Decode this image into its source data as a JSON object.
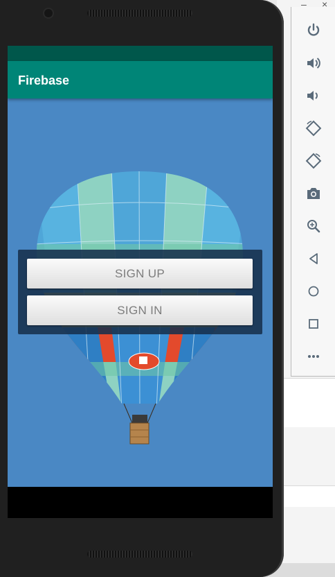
{
  "app": {
    "title": "Firebase"
  },
  "buttons": {
    "sign_up": "SIGN UP",
    "sign_in": "SIGN IN"
  },
  "emulator_toolbar": {
    "window_minimize": "–",
    "window_close": "×",
    "tools": [
      "power-icon",
      "volume-up-icon",
      "volume-down-icon",
      "rotate-left-icon",
      "rotate-right-icon",
      "camera-icon",
      "zoom-icon",
      "back-icon",
      "home-icon",
      "overview-icon",
      "more-icon"
    ]
  },
  "colors": {
    "status_bar": "#00574b",
    "app_bar": "#008577",
    "sky": "#4a88c4",
    "panel": "#17304c",
    "toolbar_icon": "#5a6b7a"
  }
}
